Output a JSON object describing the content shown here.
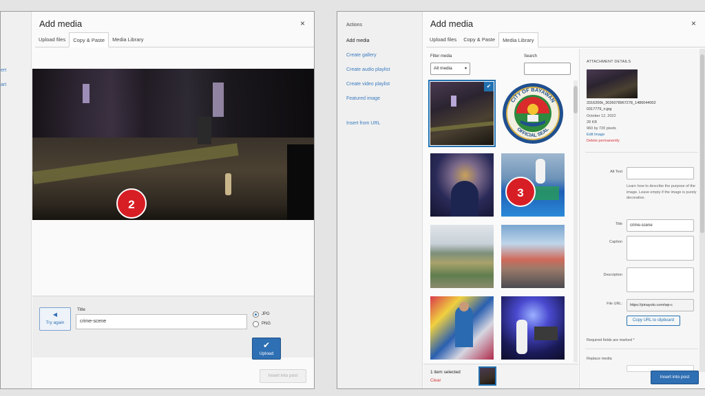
{
  "left_dialog": {
    "sidebar_items": [
      "ert",
      "art"
    ],
    "title": "Add media",
    "close": "×",
    "tabs": [
      "Upload files",
      "Copy & Paste",
      "Media Library"
    ],
    "active_tab": 1,
    "badge": "2",
    "try_again": {
      "icon": "speaker-icon",
      "label": "Try again"
    },
    "title_label": "Title",
    "title_value": "crime-scene",
    "radio_options": [
      "JPG",
      "PNG"
    ],
    "selected_radio": "JPG",
    "upload_button": "Upload",
    "insert_button": "Insert into post"
  },
  "right_dialog": {
    "sidebar": {
      "header": "Actions",
      "items": [
        "Add media",
        "Create gallery",
        "Create audio playlist",
        "Create video playlist",
        "Featured image",
        "Insert from URL"
      ],
      "active_item": "Add media"
    },
    "title": "Add media",
    "close": "×",
    "tabs": [
      "Upload files",
      "Copy & Paste",
      "Media Library"
    ],
    "active_tab": 2,
    "filter_label": "Filter media",
    "filter_value": "All media",
    "search_label": "Search",
    "search_value": "",
    "badge": "3",
    "thumbnails": [
      "night crime scene",
      "City of Bayawan official seal",
      "person at night",
      "meeting crowd",
      "mountain landscape",
      "gathering crowd",
      "man speaking at podium",
      "stage performer"
    ],
    "selected_thumbnail": 0,
    "seal_text": [
      "CITY OF BAYAWAN",
      "OFFICIAL SEAL"
    ],
    "selection": {
      "count": "1 item selected",
      "clear": "Clear"
    },
    "details": {
      "heading": "ATTACHMENT DETAILS",
      "filename_line1": "3316200k_3026078967278_1486044002",
      "filename_line2": "0317779_n.jpg",
      "date": "October 12, 2022",
      "size": "28 KB",
      "dimensions": "960 by 720 pixels",
      "edit_link": "Edit Image",
      "delete_link": "Delete permanently",
      "alt_label": "Alt Text",
      "alt_value": "",
      "alt_help": "Learn how to describe the purpose of the image. Leave empty if the image is purely decorative.",
      "title_label": "Title",
      "title_value": "crime-scene",
      "caption_label": "Caption",
      "description_label": "Description",
      "fileurl_label": "File URL:",
      "fileurl_value": "https://pinayolo.com/wp-c",
      "copy_button": "Copy URL to clipboard",
      "required_note": "Required fields are marked *",
      "display_heading": "Replace media"
    },
    "insert_button": "Insert into post"
  }
}
